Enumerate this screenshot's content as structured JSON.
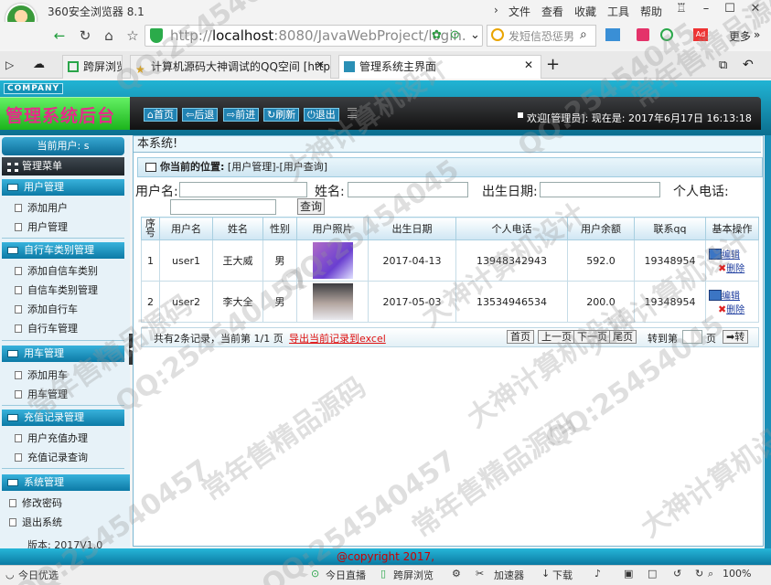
{
  "browser": {
    "title": "360安全浏览器 8.1",
    "menu": [
      "文件",
      "查看",
      "收藏",
      "工具",
      "帮助"
    ],
    "url_prefix": "http://",
    "url_host": "localhost",
    "url_rest": ":8080/JavaWebProject/login.",
    "search_placeholder": "发短信恐惩男",
    "more": "更多"
  },
  "tabs": [
    {
      "label": "跨屏浏览"
    },
    {
      "label": "计算机源码大神调试的QQ空间 [http:"
    },
    {
      "label": "管理系统主界面"
    }
  ],
  "header": {
    "company": "COMPANY",
    "title": "管理系统后台",
    "toolbar": [
      "首页",
      "后退",
      "前进",
      "刷新",
      "退出"
    ],
    "welcome": "欢迎[管理员]:  现在是: 2017年6月17日 16:13:18"
  },
  "sidebar": {
    "current_user": "当前用户: s",
    "menu_title": "管理菜单",
    "groups": [
      {
        "title": "用户管理",
        "items": [
          "添加用户",
          "用户管理"
        ]
      },
      {
        "title": "自行车类别管理",
        "items": [
          "添加自信车类别",
          "自信车类别管理",
          "添加自行车",
          "自行车管理"
        ]
      },
      {
        "title": "用车管理",
        "items": [
          "添加用车",
          "用车管理"
        ]
      },
      {
        "title": "充值记录管理",
        "items": [
          "用户充值办理",
          "充值记录查询"
        ]
      },
      {
        "title": "系统管理",
        "items": [
          "修改密码",
          "退出系统"
        ]
      }
    ],
    "version": "版本: 2017V1.0"
  },
  "main": {
    "title": "本系统!",
    "location_label": "你当前的位置:",
    "location": "[用户管理]-[用户查询]",
    "search": {
      "username": "用户名:",
      "name": "姓名:",
      "birth": "出生日期:",
      "phone": "个人电话:",
      "button": "查询"
    },
    "columns": [
      "序号",
      "用户名",
      "姓名",
      "性别",
      "用户照片",
      "出生日期",
      "个人电话",
      "用户余额",
      "联系qq",
      "基本操作"
    ],
    "rows": [
      {
        "no": "1",
        "user": "user1",
        "name": "王大威",
        "sex": "男",
        "birth": "2017-04-13",
        "phone": "13948342943",
        "balance": "592.0",
        "qq": "19348954"
      },
      {
        "no": "2",
        "user": "user2",
        "name": "李大全",
        "sex": "男",
        "birth": "2017-05-03",
        "phone": "13534946534",
        "balance": "200.0",
        "qq": "19348954"
      }
    ],
    "edit_label": "编辑",
    "delete_label": "删除",
    "pager": {
      "info": "共有2条记录，当前第 1/1 页",
      "export": "导出当前记录到excel",
      "buttons": [
        "首页",
        "上一页",
        "下一页",
        "尾页"
      ],
      "goto": "转到第",
      "page_unit": "页",
      "go": "转"
    }
  },
  "footer": {
    "copyright": "@copyright 2017,"
  },
  "statusbar": {
    "left": "今日优选",
    "items": [
      "今日直播",
      "跨屏浏览",
      "加速器",
      "下载",
      "100%"
    ]
  },
  "watermarks": [
    "QQ:25454045",
    "大神计算机设计",
    "常年售精品源码",
    "QQ:25454045",
    "大神计算机设计",
    "常年售精品源码",
    "QQ:254540457",
    "大神计算机设计",
    "常年售精品源码",
    "QQ:25454045",
    "QQ:25454045",
    "常年售精品源码",
    "QQ:254540457",
    "大神计算机设计",
    "QQ:254540457",
    "大神计算机设计"
  ]
}
